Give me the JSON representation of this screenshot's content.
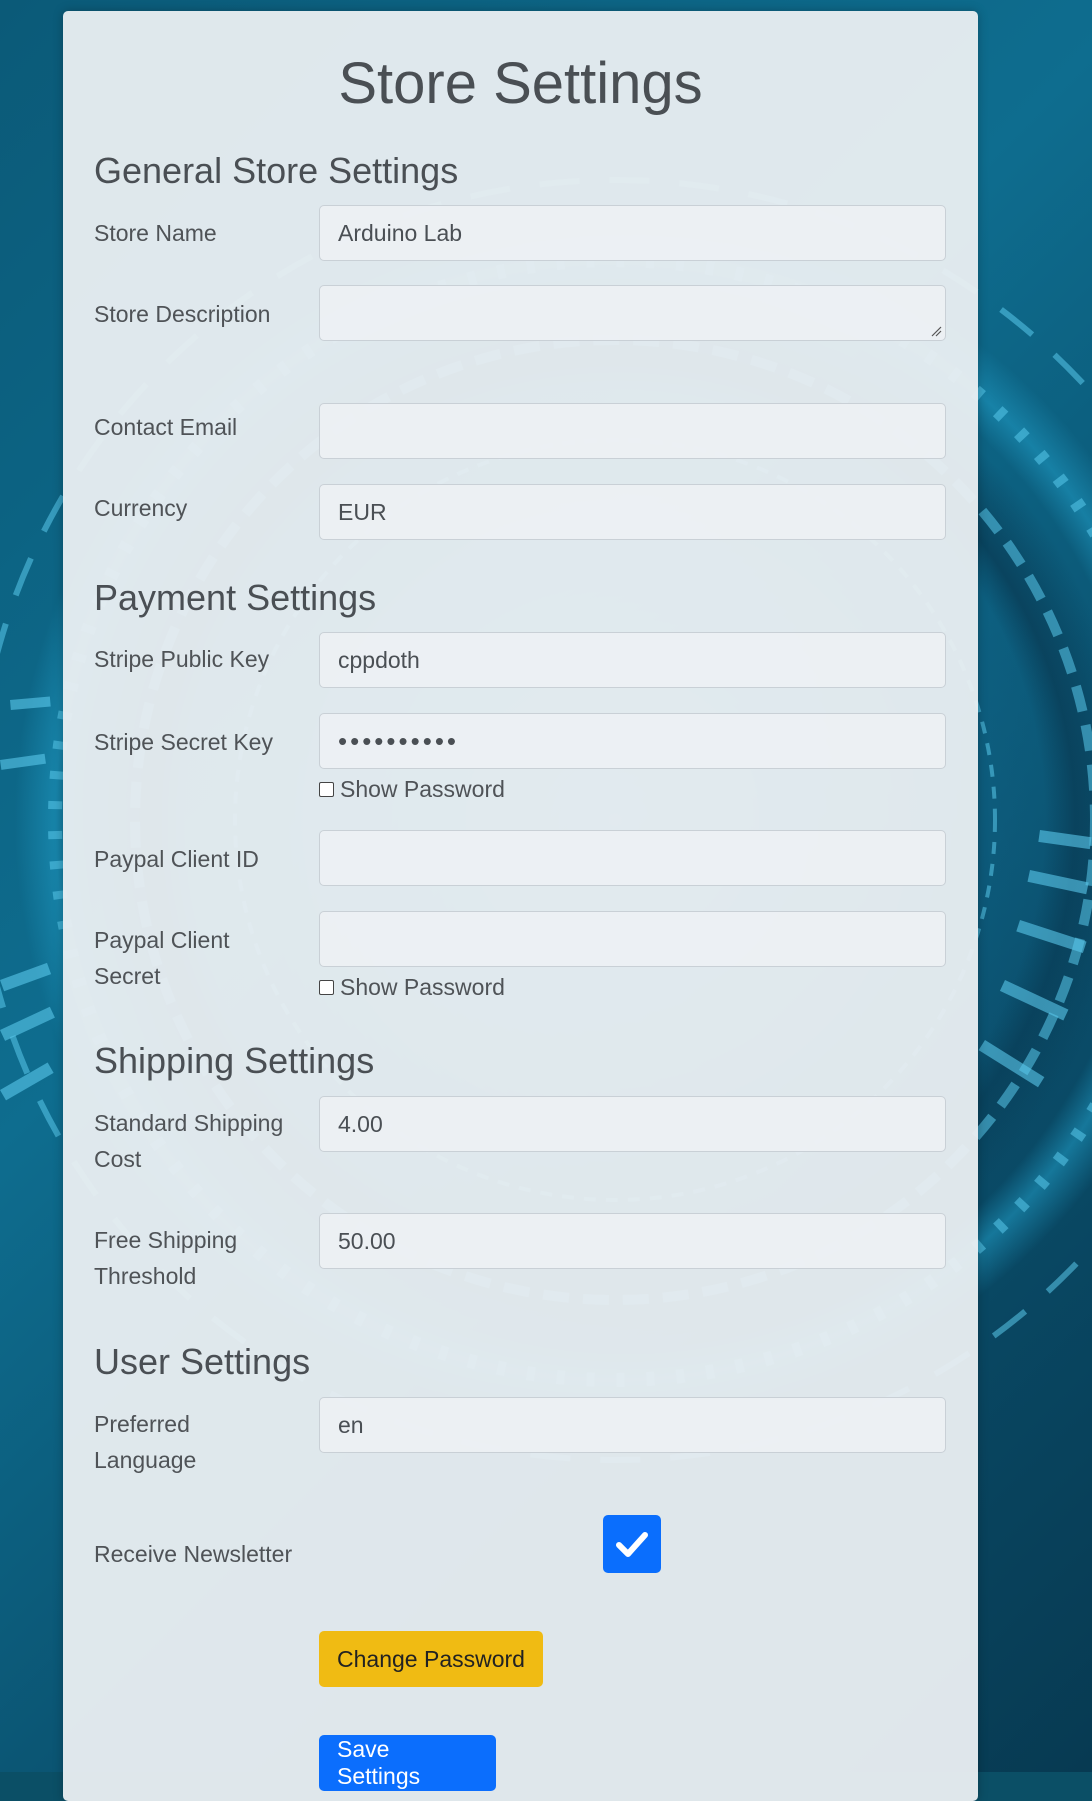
{
  "page": {
    "title": "Store Settings"
  },
  "sections": {
    "general": {
      "heading": "General Store Settings",
      "store_name": {
        "label": "Store Name",
        "value": "Arduino Lab"
      },
      "store_description": {
        "label": "Store Description",
        "value": ""
      },
      "contact_email": {
        "label": "Contact Email",
        "value": ""
      },
      "currency": {
        "label": "Currency",
        "value": "EUR"
      }
    },
    "payment": {
      "heading": "Payment Settings",
      "stripe_public_key": {
        "label": "Stripe Public Key",
        "value": "cppdoth"
      },
      "stripe_secret_key": {
        "label": "Stripe Secret Key",
        "masked_value": "••••••••••",
        "show_password_label": "Show Password",
        "show_password_checked": false
      },
      "paypal_client_id": {
        "label": "Paypal Client ID",
        "value": ""
      },
      "paypal_client_secret": {
        "label": "Paypal Client Secret",
        "masked_value": "",
        "show_password_label": "Show Password",
        "show_password_checked": false
      }
    },
    "shipping": {
      "heading": "Shipping Settings",
      "standard_shipping_cost": {
        "label": "Standard Shipping Cost",
        "value": "4.00"
      },
      "free_shipping_threshold": {
        "label": "Free Shipping Threshold",
        "value": "50.00"
      }
    },
    "user": {
      "heading": "User Settings",
      "preferred_language": {
        "label": "Preferred Language",
        "value": "en"
      },
      "receive_newsletter": {
        "label": "Receive Newsletter",
        "checked": true
      }
    }
  },
  "actions": {
    "change_password_label": "Change Password",
    "save_settings_label": "Save Settings"
  },
  "colors": {
    "accent_blue": "#0b6efd",
    "warning_yellow": "#f0bb13",
    "background_teal": "#0b5a78"
  }
}
